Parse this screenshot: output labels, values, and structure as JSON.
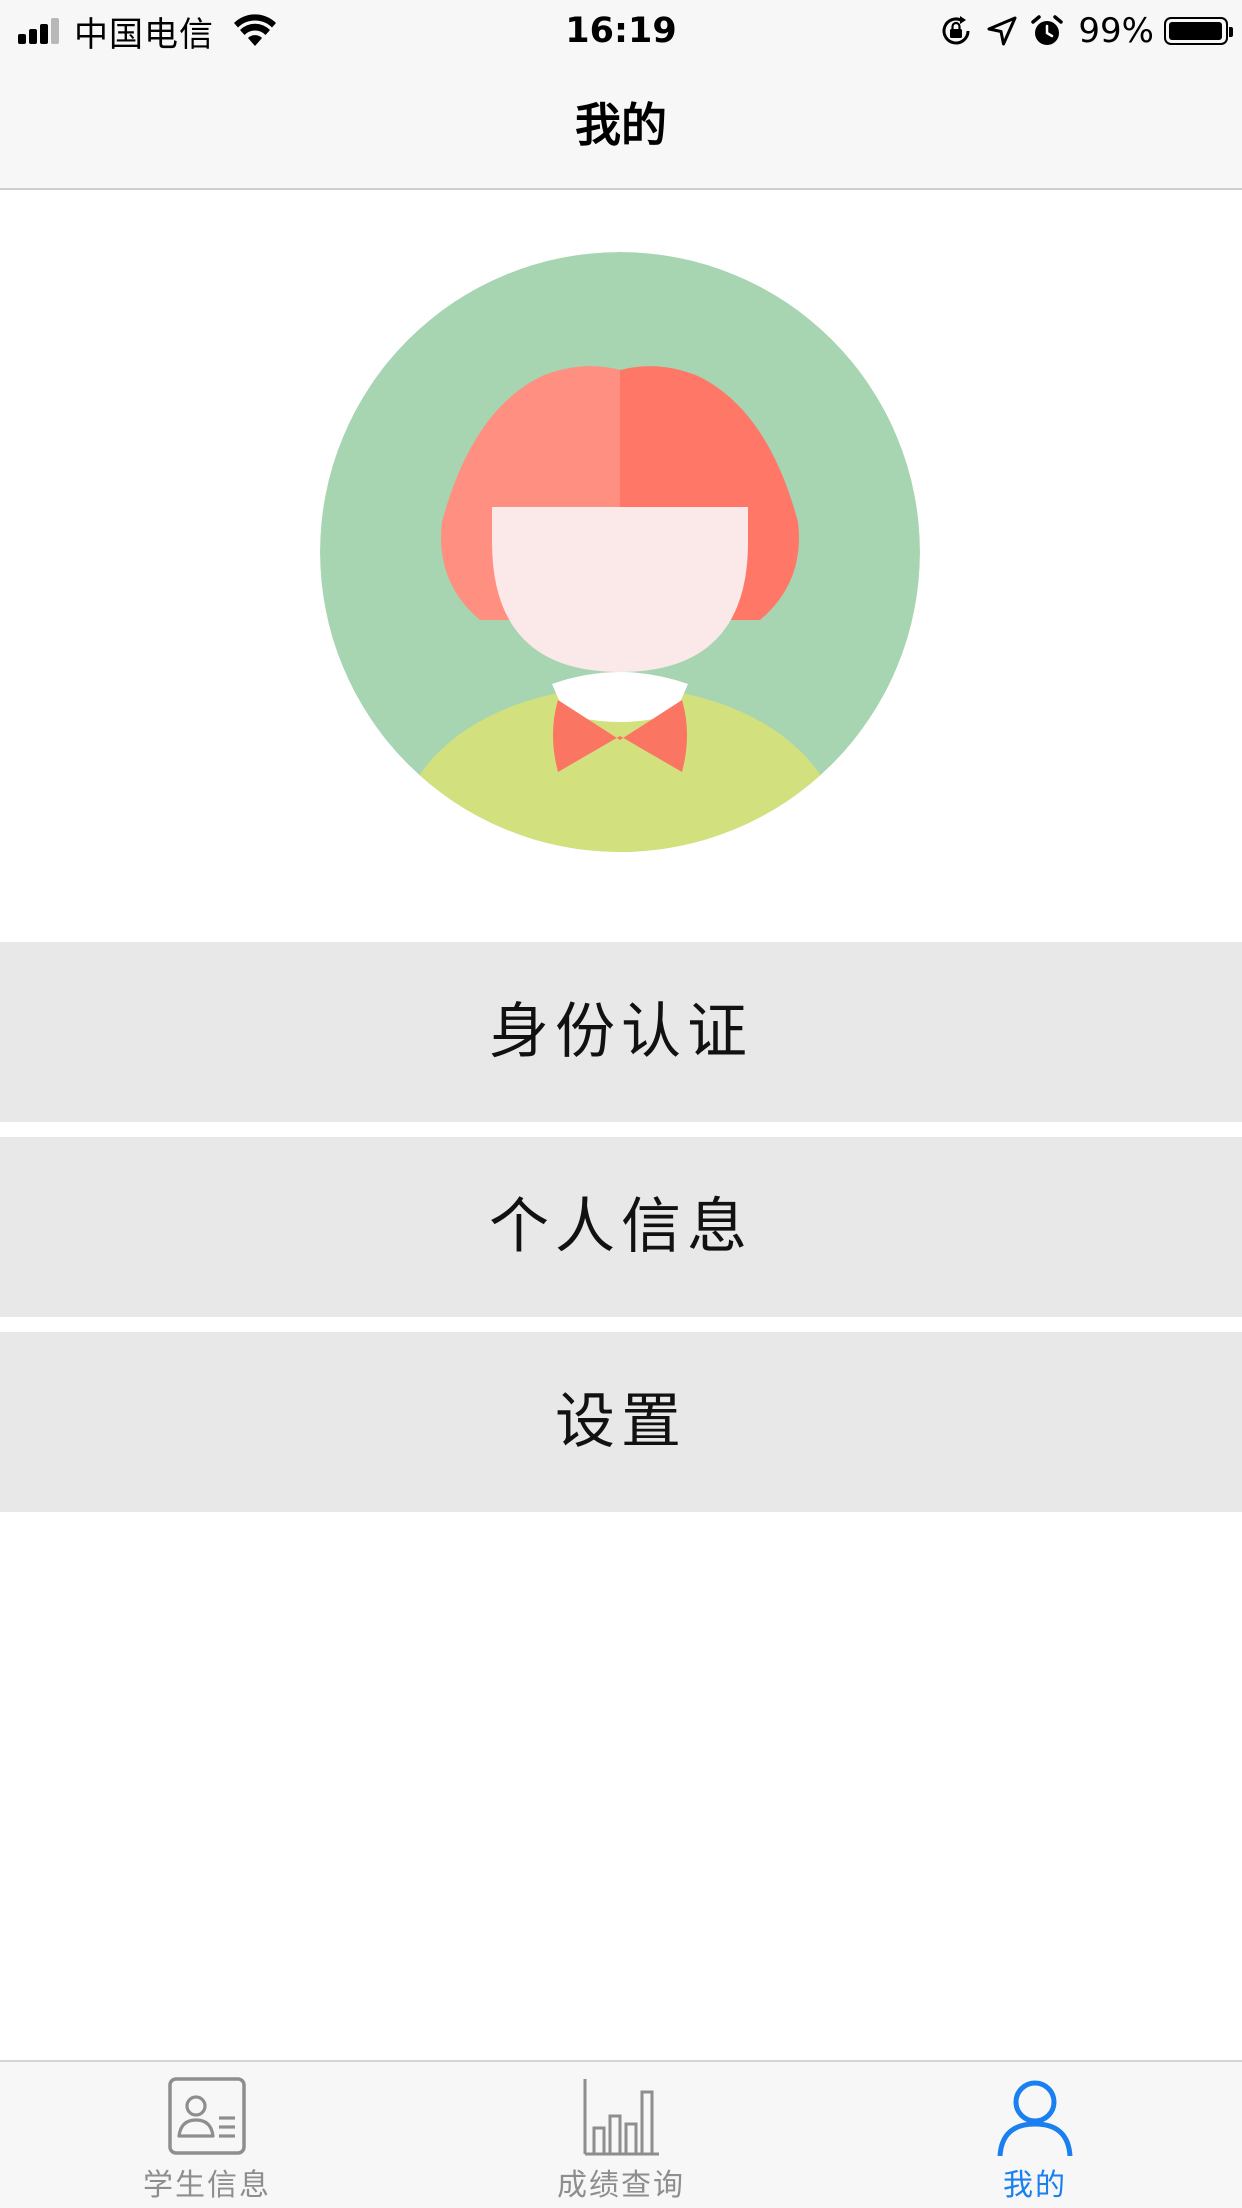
{
  "status_bar": {
    "carrier": "中国电信",
    "time": "16:19",
    "battery_text": "99%",
    "battery_level": 0.99,
    "signal_bars": 3,
    "icons": [
      "signal-icon",
      "wifi-icon",
      "rotation-lock-icon",
      "location-icon",
      "alarm-icon",
      "battery-icon"
    ]
  },
  "nav": {
    "title": "我的"
  },
  "profile": {
    "avatar_icon": "girl-avatar-icon",
    "colors": {
      "circle": "#a7d4b1",
      "hair_light": "#ff8f80",
      "hair_dark": "#ff7867",
      "face": "#fbe8e9",
      "shirt": "#d2e07d",
      "bow": "#fa7562"
    }
  },
  "menu": {
    "items": [
      {
        "label": "身份认证"
      },
      {
        "label": "个人信息"
      },
      {
        "label": "设置"
      }
    ]
  },
  "tab_bar": {
    "active_color": "#1a7ff0",
    "inactive_color": "#8e8e8e",
    "tabs": [
      {
        "label": "学生信息",
        "icon": "id-card-icon",
        "active": false
      },
      {
        "label": "成绩查询",
        "icon": "bar-chart-icon",
        "active": false
      },
      {
        "label": "我的",
        "icon": "person-icon",
        "active": true
      }
    ]
  }
}
